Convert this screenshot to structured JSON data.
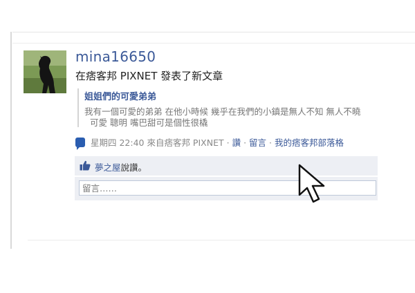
{
  "post": {
    "username": "mina16650",
    "headline": "在痞客邦 PIXNET 發表了新文章",
    "article": {
      "title": "姐姐們的可愛弟弟",
      "excerpt_line1": "我有一個可愛的弟弟 在他小時候 幾乎在我們的小鎮是無人不知 無人不曉",
      "excerpt_line2": "可愛 聰明 嘴巴甜可是個性很橇"
    },
    "meta": {
      "timestamp": "星期四 22:40 來自痞客邦 PIXNET",
      "like_link": "讚",
      "comment_link": "留言",
      "blog_link": "我的痞客邦部落格",
      "separator": "·"
    },
    "likes": {
      "liker": "夢之屋",
      "suffix": "說讚。"
    },
    "comment_box": {
      "placeholder": "留言……"
    }
  },
  "colors": {
    "link": "#3b5998",
    "panel_bg": "#edeff4"
  },
  "icons": [
    "comment-bubble-icon",
    "thumbs-up-icon",
    "mouse-pointer-icon"
  ]
}
